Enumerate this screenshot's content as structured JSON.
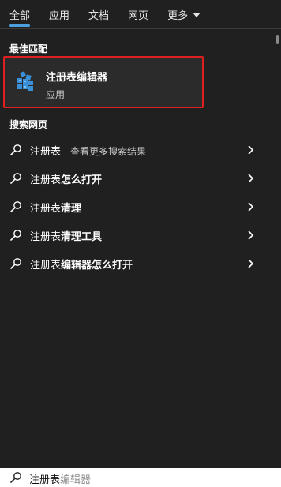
{
  "tabs": [
    {
      "label": "全部",
      "active": true
    },
    {
      "label": "应用",
      "active": false
    },
    {
      "label": "文档",
      "active": false
    },
    {
      "label": "网页",
      "active": false
    },
    {
      "label": "更多",
      "active": false
    }
  ],
  "best_match": {
    "section_title": "最佳匹配",
    "app_name": "注册表编辑器",
    "app_type": "应用",
    "highlight_color": "#e02020",
    "icon": "registry-editor-icon"
  },
  "web_search": {
    "section_title": "搜索网页",
    "items": [
      {
        "prefix": "注册表",
        "bold": "",
        "suffix": " - 查看更多搜索结果"
      },
      {
        "prefix": "注册表",
        "bold": "怎么打开",
        "suffix": ""
      },
      {
        "prefix": "注册表",
        "bold": "清理",
        "suffix": ""
      },
      {
        "prefix": "注册表",
        "bold": "清理工具",
        "suffix": ""
      },
      {
        "prefix": "注册表",
        "bold": "编辑器怎么打开",
        "suffix": ""
      }
    ]
  },
  "search": {
    "typed": "注册表",
    "autocomplete": "编辑器"
  }
}
